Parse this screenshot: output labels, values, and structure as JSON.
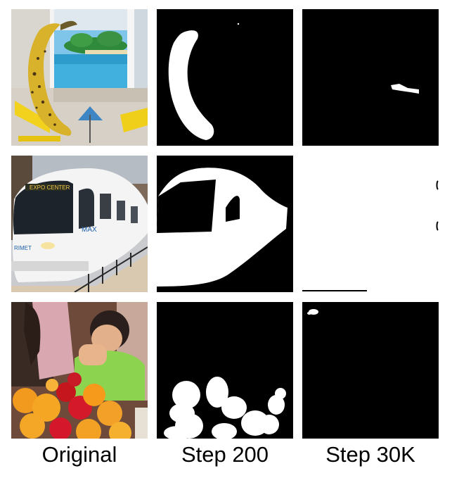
{
  "columns": [
    {
      "label": "Original"
    },
    {
      "label": "Step 200"
    },
    {
      "label": "Step 30K"
    }
  ],
  "rows": [
    {
      "subject": "banana"
    },
    {
      "subject": "train"
    },
    {
      "subject": "fruit"
    }
  ],
  "colors": {
    "mask_background": "#000000",
    "mask_foreground": "#ffffff"
  }
}
